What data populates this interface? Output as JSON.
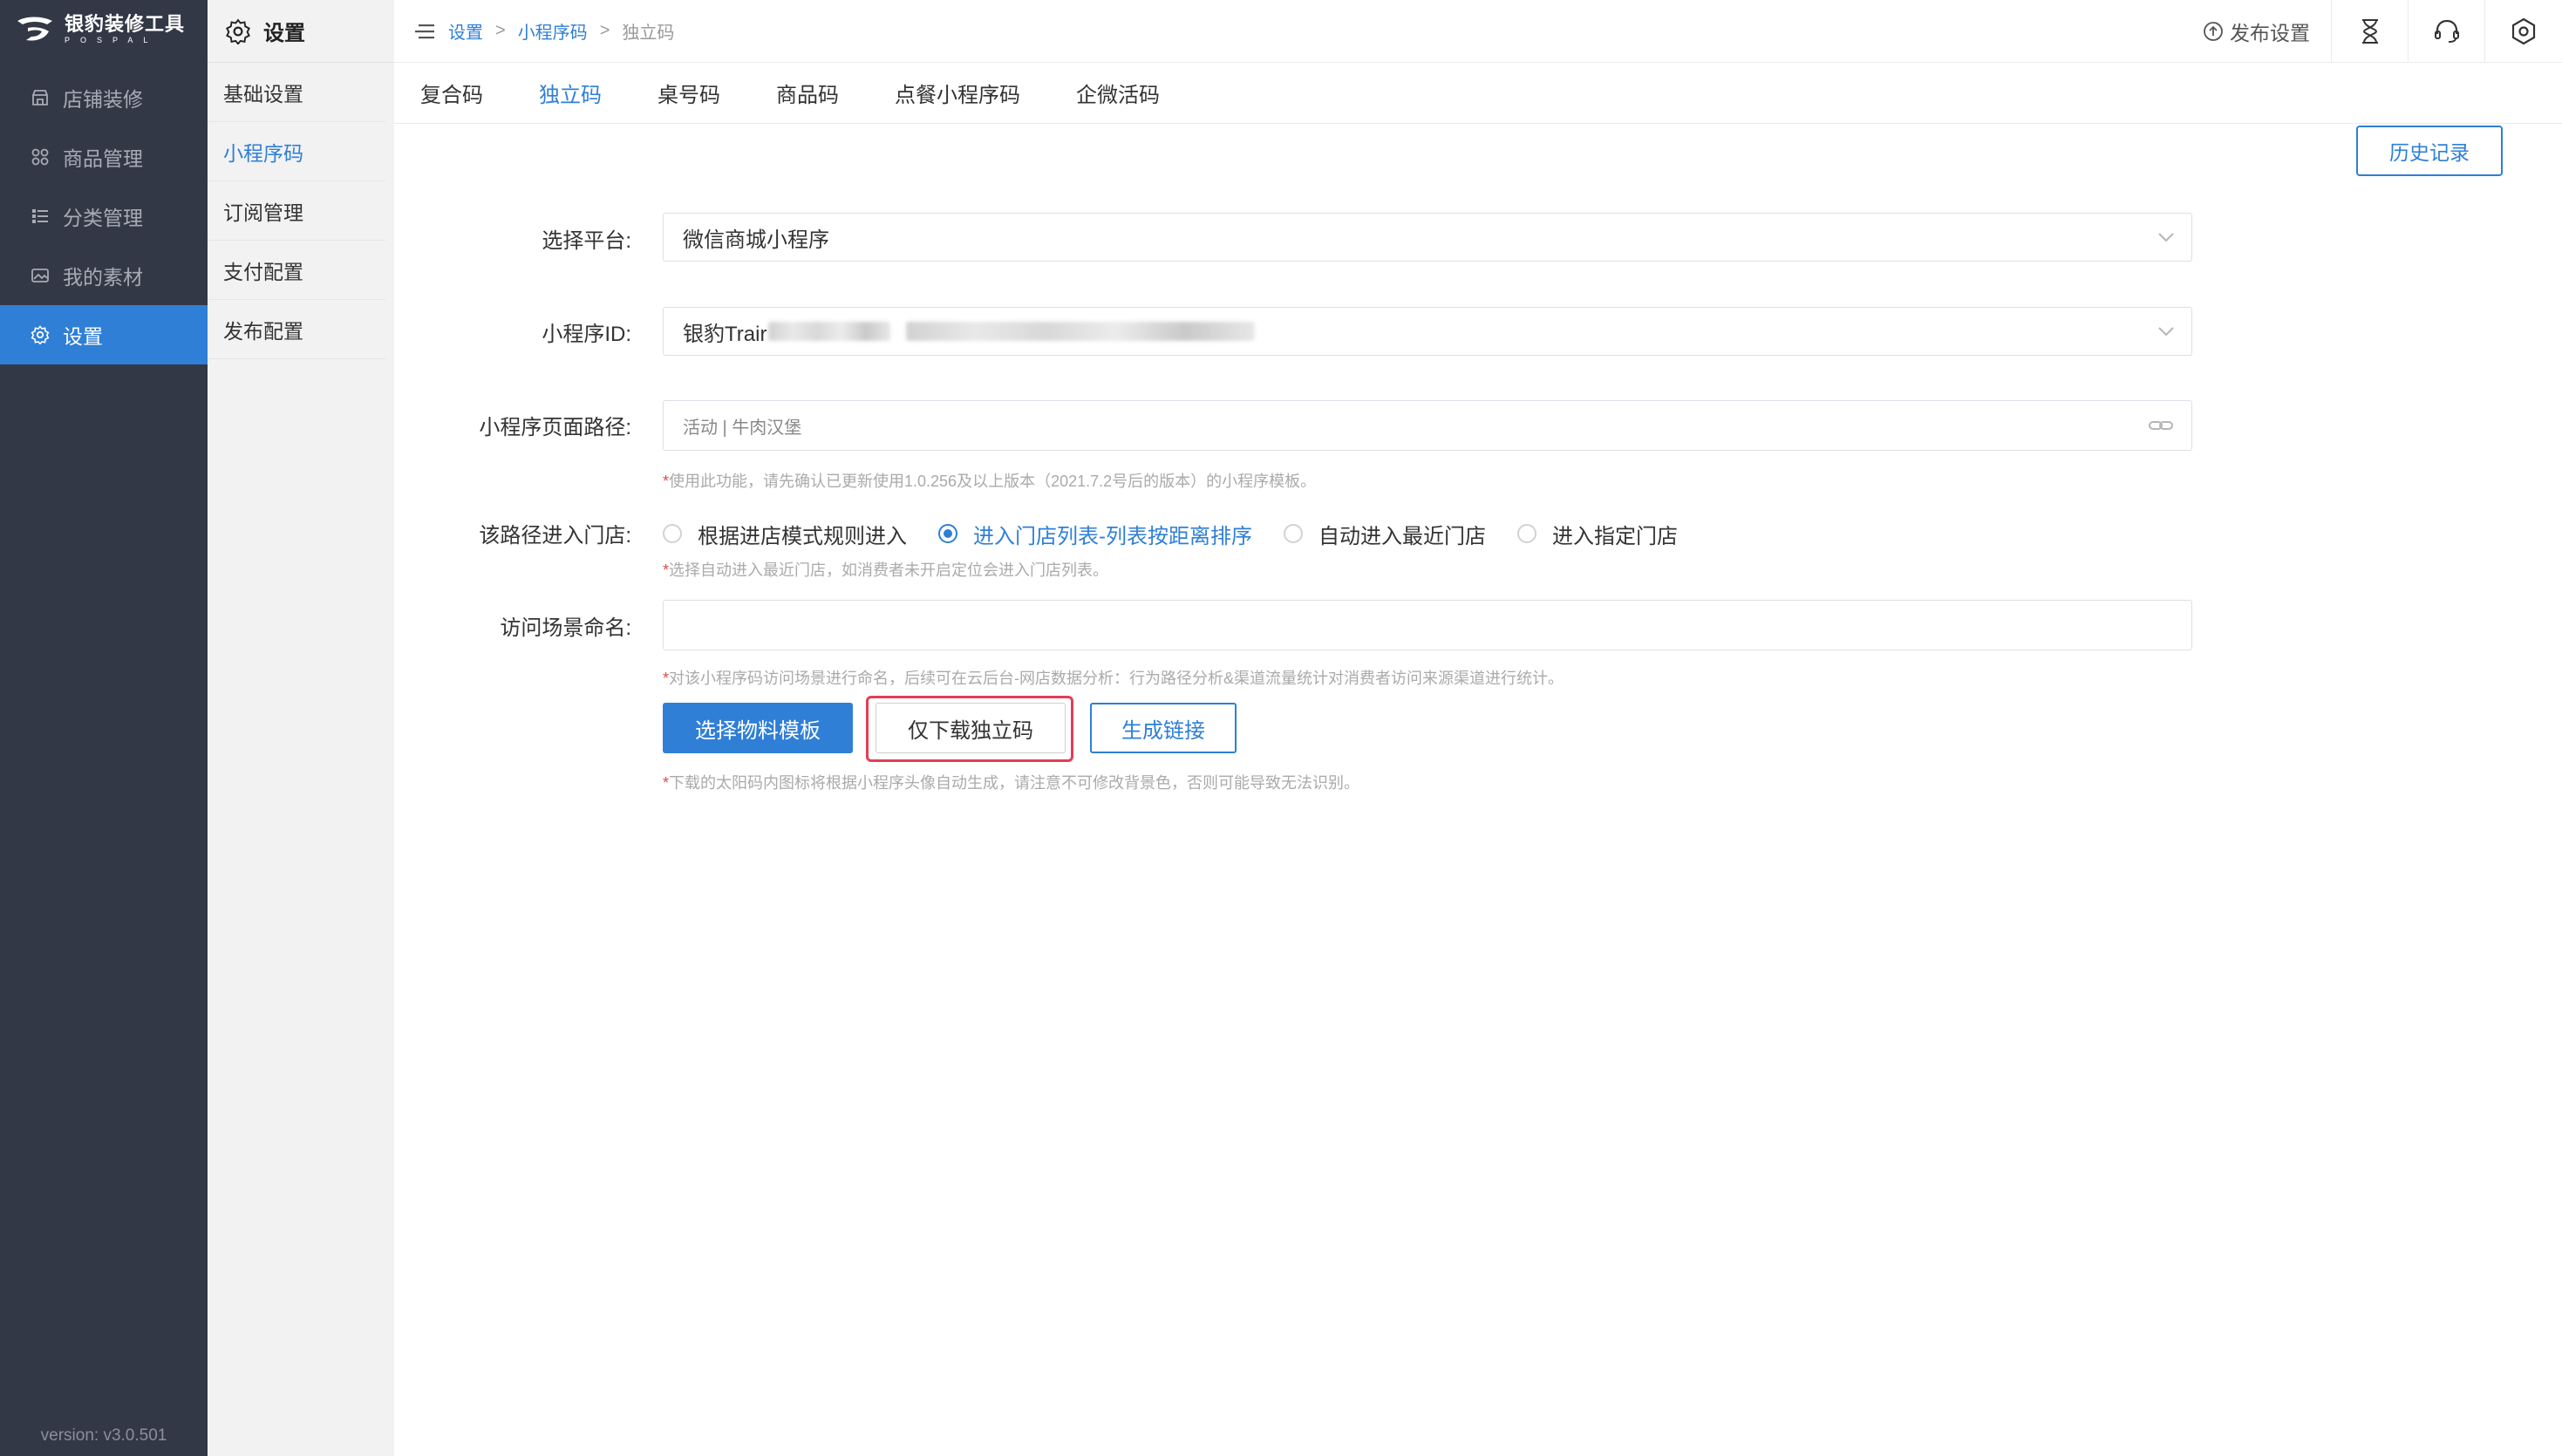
{
  "app": {
    "logo_text": "银豹装修工具",
    "logo_sub": "POSPAL",
    "version": "version: v3.0.501"
  },
  "nav": {
    "items": [
      {
        "label": "店铺装修",
        "icon": "storefront-icon"
      },
      {
        "label": "商品管理",
        "icon": "grid-icon"
      },
      {
        "label": "分类管理",
        "icon": "list-icon"
      },
      {
        "label": "我的素材",
        "icon": "image-icon"
      },
      {
        "label": "设置",
        "icon": "gear-icon",
        "active": true
      }
    ]
  },
  "subnav": {
    "title": "设置",
    "items": [
      {
        "label": "基础设置"
      },
      {
        "label": "小程序码",
        "active": true
      },
      {
        "label": "订阅管理"
      },
      {
        "label": "支付配置"
      },
      {
        "label": "发布配置"
      }
    ]
  },
  "breadcrumb": {
    "items": [
      "设置",
      "小程序码",
      "独立码"
    ],
    "separator": ">"
  },
  "topbar": {
    "publish_label": "发布设置",
    "icons": [
      "hourglass-icon",
      "headset-icon",
      "hexagon-settings-icon"
    ]
  },
  "tabs": [
    "复合码",
    "独立码",
    "桌号码",
    "商品码",
    "点餐小程序码",
    "企微活码"
  ],
  "active_tab": "独立码",
  "history_button": "历史记录",
  "form": {
    "platform": {
      "label": "选择平台:",
      "value": "微信商城小程序"
    },
    "appid": {
      "label": "小程序ID:",
      "value_prefix": "银豹Trair"
    },
    "page_path": {
      "label": "小程序页面路径:",
      "value": "活动 | 牛肉汉堡",
      "hint": "使用此功能，请先确认已更新使用1.0.256及以上版本（2021.7.2号后的版本）的小程序模板。"
    },
    "store_entry": {
      "label": "该路径进入门店:",
      "options": [
        "根据进店模式规则进入",
        "进入门店列表-列表按距离排序",
        "自动进入最近门店",
        "进入指定门店"
      ],
      "selected_index": 1,
      "hint": "选择自动进入最近门店，如消费者未开启定位会进入门店列表。"
    },
    "scene_name": {
      "label": "访问场景命名:",
      "value": "",
      "hint": "对该小程序码访问场景进行命名，后续可在云后台-网店数据分析：行为路径分析&渠道流量统计对消费者访问来源渠道进行统计。"
    },
    "buttons": {
      "primary": "选择物料模板",
      "download": "仅下载独立码",
      "link": "生成链接"
    },
    "footer_hint": "下载的太阳码内图标将根据小程序头像自动生成，请注意不可修改背景色，否则可能导致无法识别。"
  },
  "colors": {
    "accent": "#2f7fd6",
    "nav_bg": "#333846",
    "highlight": "#e53d55",
    "required": "#e04a4a"
  }
}
